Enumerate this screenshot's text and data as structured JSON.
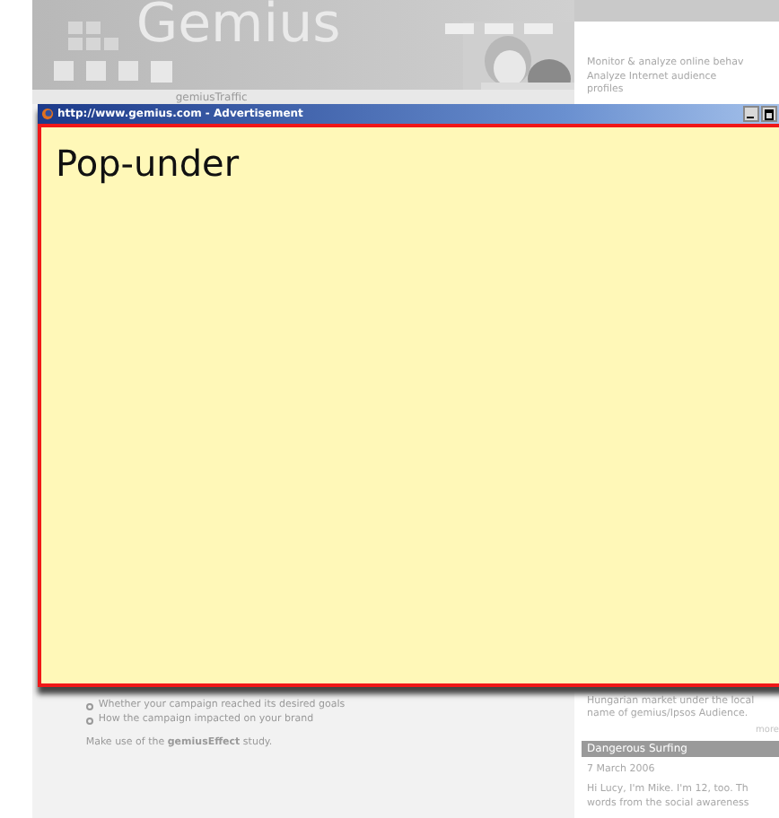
{
  "background_page": {
    "logo": "Gemius",
    "nav_link": "gemiusTraffic",
    "side_links": [
      "Monitor & analyze online behav",
      "Analyze Internet audience",
      "profiles"
    ],
    "bullets": [
      "Whether your campaign reached its desired goals",
      "How the campaign impacted on your brand"
    ],
    "closing": "Make use of the **gemiusEffect** study.",
    "news_text": [
      "Hungarian market under the local",
      "name of gemius/Ipsos Audience."
    ],
    "more_link": "more",
    "section_title": "Dangerous Surfing",
    "date": "7 March 2006",
    "teaser": [
      "Hi Lucy, I'm Mike. I'm 12, too. Th",
      "words from the social awareness"
    ]
  },
  "popup": {
    "title": "http://www.gemius.com - Advertisement",
    "heading": "Pop-under"
  }
}
